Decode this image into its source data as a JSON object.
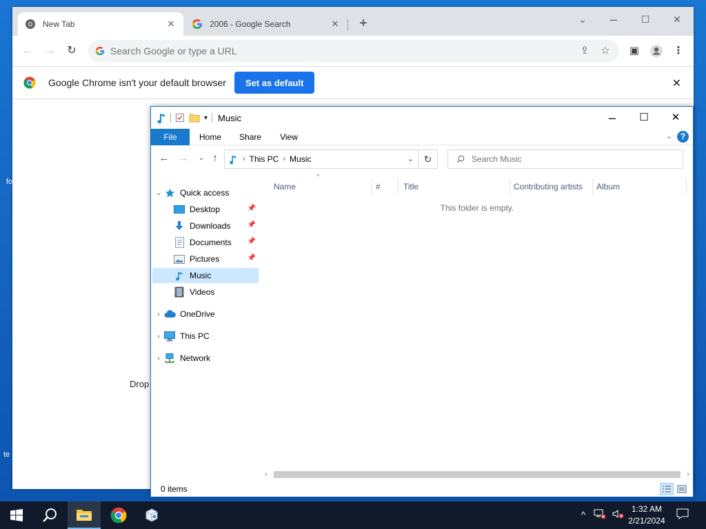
{
  "desktop": {
    "frag_1": "fo",
    "frag_2": "te"
  },
  "chrome": {
    "tabs": [
      {
        "label": "New Tab",
        "icon": "chrome-logo-icon"
      },
      {
        "label": "2006 - Google Search",
        "icon": "google-g-icon"
      }
    ],
    "omnibox_placeholder": "Search Google or type a URL",
    "infobar": {
      "message": "Google Chrome isn't your default browser",
      "button": "Set as default"
    },
    "page_fragment": "Drop"
  },
  "explorer": {
    "title": "Music",
    "ribbon_tabs": [
      "File",
      "Home",
      "Share",
      "View"
    ],
    "help": "?",
    "address": {
      "crumbs": [
        "This PC",
        "Music"
      ]
    },
    "search_placeholder": "Search Music",
    "nav": {
      "quick_access": "Quick access",
      "items": [
        {
          "label": "Desktop",
          "pinned": true
        },
        {
          "label": "Downloads",
          "pinned": true
        },
        {
          "label": "Documents",
          "pinned": true
        },
        {
          "label": "Pictures",
          "pinned": true
        },
        {
          "label": "Music",
          "pinned": false,
          "selected": true
        },
        {
          "label": "Videos",
          "pinned": false
        }
      ],
      "roots": [
        "OneDrive",
        "This PC",
        "Network"
      ]
    },
    "columns": [
      "Name",
      "#",
      "Title",
      "Contributing artists",
      "Album"
    ],
    "empty_message": "This folder is empty.",
    "status": "0 items"
  },
  "taskbar": {
    "time": "1:32 AM",
    "date": "2/21/2024"
  },
  "colors": {
    "accent": "#1a73e8",
    "explorer_blue": "#1979ca",
    "selection": "#cce8ff",
    "taskbar": "#101a2a"
  }
}
